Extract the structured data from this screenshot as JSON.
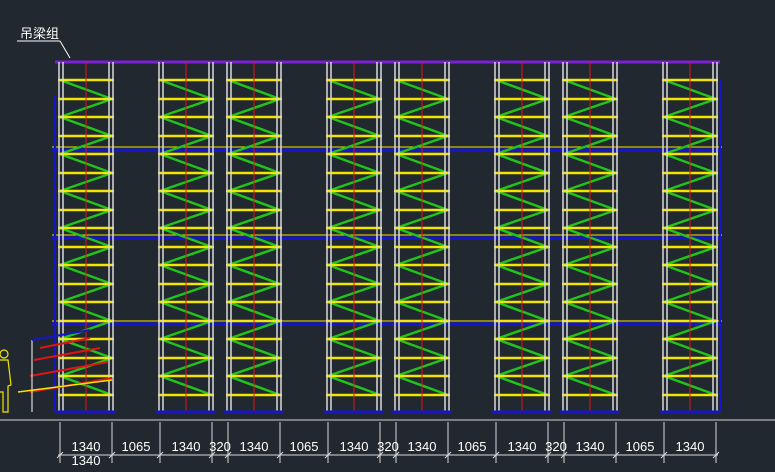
{
  "drawing": {
    "label": "吊梁组",
    "dimensions": [
      "1340",
      "1065",
      "1340",
      "320",
      "1340",
      "1065",
      "1340",
      "320",
      "1340",
      "1065",
      "1340",
      "320",
      "1340",
      "1065",
      "1340"
    ],
    "extra_dimension": "1340"
  },
  "colors": {
    "background": "#212830",
    "standard": "#d9d9d9",
    "ledger": "#f2e600",
    "diagonal": "#22c41c",
    "beam": "#1616c8",
    "centerline": "#e01414",
    "top_beam": "#7b1fd9",
    "figure": "#f2e600"
  }
}
